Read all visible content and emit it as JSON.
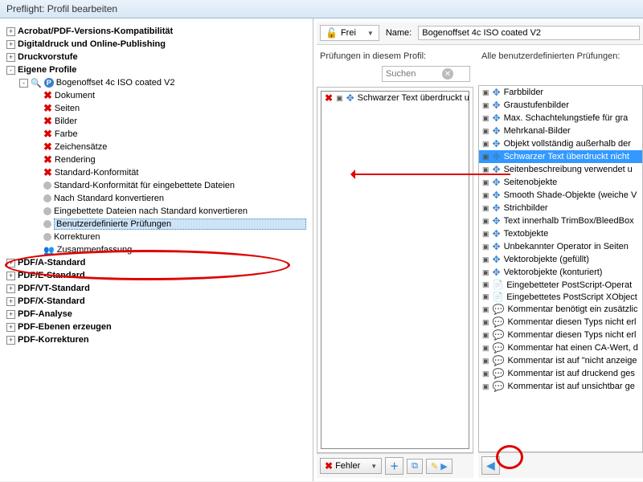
{
  "window": {
    "title": "Preflight: Profil bearbeiten"
  },
  "toolbar": {
    "lock_label": "Frei",
    "name_label": "Name:",
    "name_value": "Bogenoffset 4c ISO coated V2"
  },
  "tree": {
    "roots": [
      {
        "label": "Acrobat/PDF-Versions-Kompatibilität",
        "pm": "+"
      },
      {
        "label": "Digitaldruck und Online-Publishing",
        "pm": "+"
      },
      {
        "label": "Druckvorstufe",
        "pm": "+"
      },
      {
        "label": "Eigene Profile",
        "pm": "-"
      },
      {
        "label": "PDF/A-Standard",
        "pm": "+"
      },
      {
        "label": "PDF/E-Standard",
        "pm": "+"
      },
      {
        "label": "PDF/VT-Standard",
        "pm": "+"
      },
      {
        "label": "PDF/X-Standard",
        "pm": "+"
      },
      {
        "label": "PDF-Analyse",
        "pm": "+"
      },
      {
        "label": "PDF-Ebenen erzeugen",
        "pm": "+"
      },
      {
        "label": "PDF-Korrekturen",
        "pm": "+"
      }
    ],
    "profile": {
      "label": "Bogenoffset 4c ISO coated V2",
      "items": [
        {
          "icon": "x",
          "label": "Dokument"
        },
        {
          "icon": "x",
          "label": "Seiten"
        },
        {
          "icon": "x",
          "label": "Bilder"
        },
        {
          "icon": "x",
          "label": "Farbe"
        },
        {
          "icon": "x",
          "label": "Zeichensätze"
        },
        {
          "icon": "x",
          "label": "Rendering"
        },
        {
          "icon": "x",
          "label": "Standard-Konformität"
        },
        {
          "icon": "gray",
          "label": "Standard-Konformität für eingebettete Dateien"
        },
        {
          "icon": "gray",
          "label": "Nach Standard konvertieren"
        },
        {
          "icon": "gray",
          "label": "Eingebettete Dateien nach Standard konvertieren"
        },
        {
          "icon": "gray",
          "label": "Benutzerdefinierte Prüfungen",
          "selected": true
        },
        {
          "icon": "gray",
          "label": "Korrekturen"
        },
        {
          "icon": "sum",
          "label": "Zusammenfassung"
        }
      ]
    }
  },
  "current_panel": {
    "title": "Prüfungen in diesem Profil:",
    "search_placeholder": "Suchen",
    "items": [
      {
        "icon": "x",
        "label": "Schwarzer Text überdruckt u"
      }
    ],
    "bottom": {
      "fehler": "Fehler"
    }
  },
  "all_panel": {
    "title": "Alle benutzerdefinierten Prüfungen:",
    "items": [
      {
        "icon": "move",
        "label": "Farbbilder"
      },
      {
        "icon": "move",
        "label": "Graustufenbilder"
      },
      {
        "icon": "move",
        "label": "Max. Schachtelungstiefe für gra"
      },
      {
        "icon": "move",
        "label": "Mehrkanal-Bilder"
      },
      {
        "icon": "move",
        "label": "Objekt vollständig außerhalb der"
      },
      {
        "icon": "move",
        "label": "Schwarzer Text überdruckt nicht",
        "selected": true
      },
      {
        "icon": "move",
        "label": "Seitenbeschreibung verwendet u"
      },
      {
        "icon": "move",
        "label": "Seitenobjekte"
      },
      {
        "icon": "move",
        "label": "Smooth Shade-Objekte (weiche V"
      },
      {
        "icon": "move",
        "label": "Strichbilder"
      },
      {
        "icon": "move",
        "label": "Text innerhalb TrimBox/BleedBox"
      },
      {
        "icon": "move",
        "label": "Textobjekte"
      },
      {
        "icon": "move",
        "label": "Unbekannter Operator in Seiten"
      },
      {
        "icon": "move",
        "label": "Vektorobjekte (gefüllt)"
      },
      {
        "icon": "move",
        "label": "Vektorobjekte (konturiert)"
      },
      {
        "icon": "page",
        "label": "Eingebetteter PostScript-Operat"
      },
      {
        "icon": "page",
        "label": "Eingebettetes PostScript XObject"
      },
      {
        "icon": "comment",
        "label": "Kommentar benötigt ein zusätzlic"
      },
      {
        "icon": "comment",
        "label": "Kommentar diesen Typs nicht erl"
      },
      {
        "icon": "comment",
        "label": "Kommentar diesen Typs nicht erl"
      },
      {
        "icon": "comment",
        "label": "Kommentar hat einen CA-Wert, d"
      },
      {
        "icon": "comment",
        "label": "Kommentar ist auf \"nicht anzeige"
      },
      {
        "icon": "comment",
        "label": "Kommentar ist auf druckend ges"
      },
      {
        "icon": "comment",
        "label": "Kommentar ist auf unsichtbar ge"
      }
    ]
  }
}
